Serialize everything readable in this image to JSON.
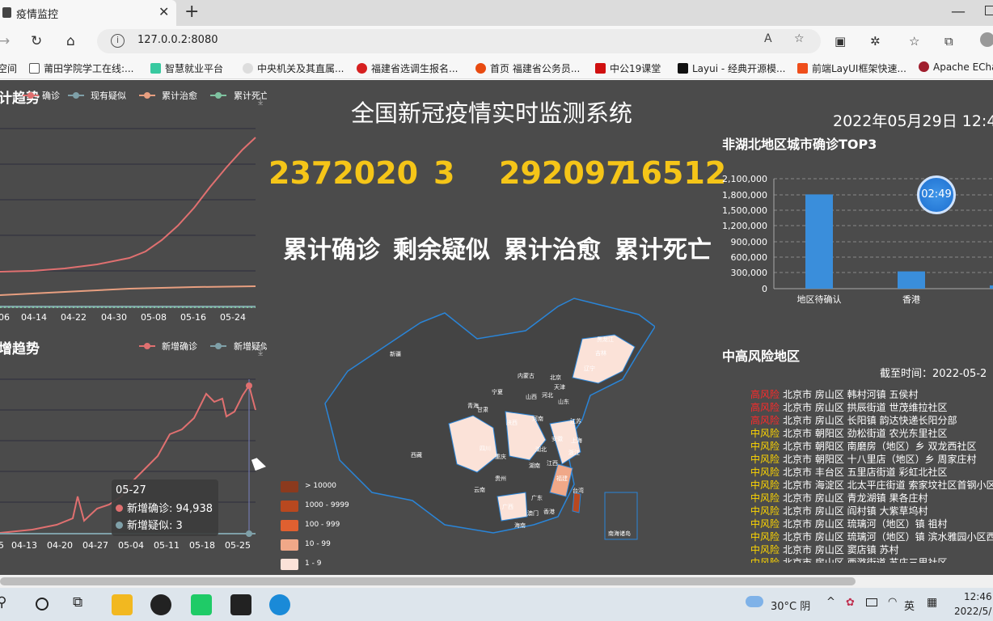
{
  "browser": {
    "tab_title": "疫情监控",
    "url": "127.0.0.2:8080"
  },
  "bookmarks": [
    "空间",
    "莆田学院学工在线:...",
    "智慧就业平台",
    "中央机关及其直属...",
    "福建省选调生报名...",
    "首页 福建省公务员...",
    "中公19课堂",
    "Layui - 经典开源模...",
    "前端LayUI框架快速...",
    "Apache ECha"
  ],
  "page": {
    "title": "全国新冠疫情实时监测系统",
    "datetime": "2022年05月29日 12:4",
    "stats": [
      {
        "value": "2372020",
        "label": "累计确诊"
      },
      {
        "value": "3",
        "label": "剩余疑似"
      },
      {
        "value": "292097",
        "label": "累计治愈"
      },
      {
        "value": "16512",
        "label": "累计死亡"
      }
    ],
    "timer": "02:49"
  },
  "colors": {
    "bg": "#4b4b4b",
    "accent": "#f5c518",
    "high": "#ff2a2a",
    "mid": "#ffd700"
  },
  "chart_data": [
    {
      "type": "line",
      "title": "计趋势",
      "series": [
        {
          "name": "确诊"
        },
        {
          "name": "现有疑似"
        },
        {
          "name": "累计治愈"
        },
        {
          "name": "累计死亡"
        }
      ],
      "x": [
        "06",
        "04-14",
        "04-22",
        "04-30",
        "05-08",
        "05-16",
        "05-24"
      ]
    },
    {
      "type": "line",
      "title": "增趋势",
      "series": [
        {
          "name": "新增确诊"
        },
        {
          "name": "新增疑似"
        }
      ],
      "x": [
        "5",
        "04-13",
        "04-20",
        "04-27",
        "05-04",
        "05-11",
        "05-18",
        "05-25"
      ],
      "tooltip": {
        "date": "05-27",
        "items": [
          "新增确诊: 94,938",
          "新增疑似: 3"
        ]
      }
    },
    {
      "type": "bar",
      "title": "非湖北地区城市确诊TOP3",
      "categories": [
        "地区待确认",
        "香港"
      ],
      "values": [
        1800000,
        330000
      ],
      "yticks": [
        "2,100,000",
        "1,800,000",
        "1,500,000",
        "1,200,000",
        "900,000",
        "600,000",
        "300,000",
        "0"
      ],
      "ylim": [
        0,
        2100000
      ]
    }
  ],
  "map": {
    "legend": [
      "> 10000",
      "1000 - 9999",
      "100 - 999",
      "10 - 99",
      "1 - 9"
    ],
    "legend_colors": [
      "#8b3a1e",
      "#b8481f",
      "#e06030",
      "#f0a888",
      "#fbe2d8"
    ],
    "provinces": [
      "黑龙江",
      "吉林",
      "辽宁",
      "内蒙古",
      "新疆",
      "北京",
      "天津",
      "河北",
      "宁夏",
      "山西",
      "山东",
      "甘肃",
      "青海",
      "陕西",
      "河南",
      "江苏",
      "西藏",
      "四川",
      "湖北",
      "安徽",
      "上海",
      "重庆",
      "浙江",
      "湖南",
      "江西",
      "贵州",
      "福建",
      "云南",
      "广西",
      "广东",
      "台湾",
      "香港",
      "澳门",
      "海南",
      "南海诸岛"
    ]
  },
  "risk": {
    "title": "中高风险地区",
    "deadline": "截至时间：2022-05-2",
    "items": [
      {
        "level": "高风险",
        "area": "北京市 房山区 韩村河镇 五侯村"
      },
      {
        "level": "高风险",
        "area": "北京市 房山区 拱辰街道 世茂维拉社区"
      },
      {
        "level": "高风险",
        "area": "北京市 房山区 长阳镇 韵达快递长阳分部"
      },
      {
        "level": "中风险",
        "area": "北京市 朝阳区 劲松街道 农光东里社区"
      },
      {
        "level": "中风险",
        "area": "北京市 朝阳区 南磨房（地区）乡 双龙西社区"
      },
      {
        "level": "中风险",
        "area": "北京市 朝阳区 十八里店（地区）乡 周家庄村"
      },
      {
        "level": "中风险",
        "area": "北京市 丰台区 五里店街道 彩虹北社区"
      },
      {
        "level": "中风险",
        "area": "北京市 海淀区 北太平庄街道 索家坟社区首钢小区"
      },
      {
        "level": "中风险",
        "area": "北京市 房山区 青龙湖镇 果各庄村"
      },
      {
        "level": "中风险",
        "area": "北京市 房山区 阎村镇 大紫草坞村"
      },
      {
        "level": "中风险",
        "area": "北京市 房山区 琉璃河（地区）镇 祖村"
      },
      {
        "level": "中风险",
        "area": "北京市 房山区 琉璃河（地区）镇 滨水雅园小区西"
      },
      {
        "level": "中风险",
        "area": "北京市 房山区 窦店镇 苏村"
      },
      {
        "level": "中风险",
        "area": "北京市 房山区 西潞街道 苏庄三里社区"
      }
    ]
  },
  "taskbar": {
    "weather": "30°C 阴",
    "time": "12:46",
    "date": "2022/5/",
    "ime": "英"
  }
}
